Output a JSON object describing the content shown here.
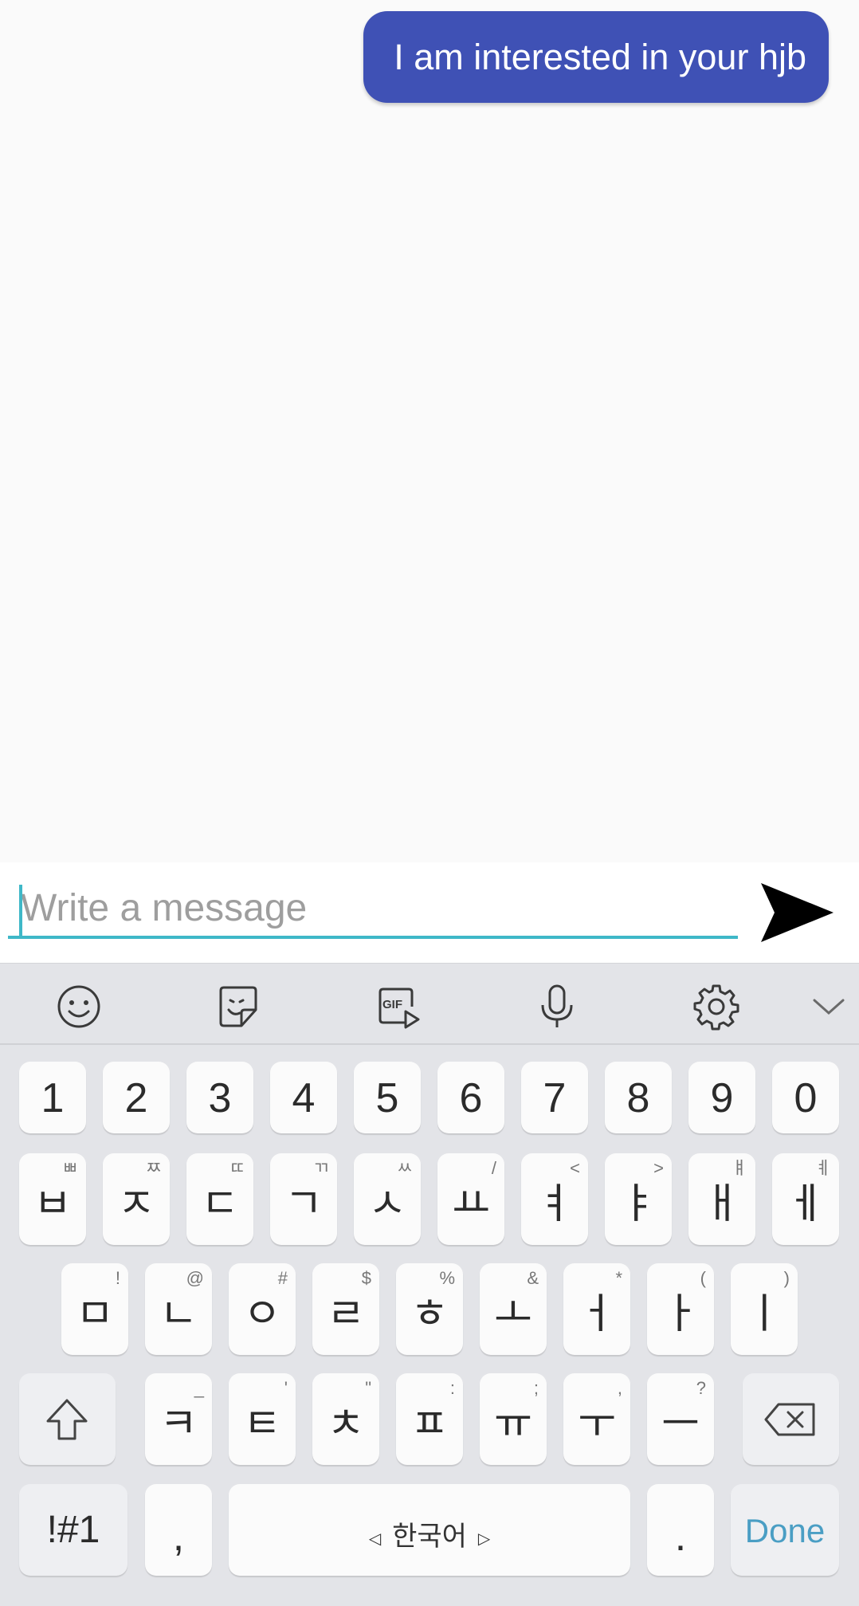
{
  "chat": {
    "messages": [
      {
        "text": "I am interested in your hjb",
        "side": "outgoing"
      }
    ],
    "bubble_color": "#3f51b5"
  },
  "composer": {
    "placeholder": "Write a message",
    "value": "",
    "accent_color": "#3fb8c8",
    "send_icon": "send-icon"
  },
  "keyboard": {
    "toolbar_icons": [
      "emoji-icon",
      "sticker-icon",
      "gif-icon",
      "microphone-icon",
      "settings-icon",
      "chevron-down-icon"
    ],
    "gif_label": "GIF",
    "number_row": [
      "1",
      "2",
      "3",
      "4",
      "5",
      "6",
      "7",
      "8",
      "9",
      "0"
    ],
    "row1": [
      {
        "main": "ㅂ",
        "sub": "ㅃ"
      },
      {
        "main": "ㅈ",
        "sub": "ㅉ"
      },
      {
        "main": "ㄷ",
        "sub": "ㄸ"
      },
      {
        "main": "ㄱ",
        "sub": "ㄲ"
      },
      {
        "main": "ㅅ",
        "sub": "ㅆ"
      },
      {
        "main": "ㅛ",
        "sub": "/"
      },
      {
        "main": "ㅕ",
        "sub": "<"
      },
      {
        "main": "ㅑ",
        "sub": ">"
      },
      {
        "main": "ㅐ",
        "sub": "ㅒ"
      },
      {
        "main": "ㅔ",
        "sub": "ㅖ"
      }
    ],
    "row2": [
      {
        "main": "ㅁ",
        "sub": "!"
      },
      {
        "main": "ㄴ",
        "sub": "@"
      },
      {
        "main": "ㅇ",
        "sub": "#"
      },
      {
        "main": "ㄹ",
        "sub": "$"
      },
      {
        "main": "ㅎ",
        "sub": "%"
      },
      {
        "main": "ㅗ",
        "sub": "&"
      },
      {
        "main": "ㅓ",
        "sub": "*"
      },
      {
        "main": "ㅏ",
        "sub": "("
      },
      {
        "main": "ㅣ",
        "sub": ")"
      }
    ],
    "row3": [
      {
        "main": "ㅋ",
        "sub": "_"
      },
      {
        "main": "ㅌ",
        "sub": "'"
      },
      {
        "main": "ㅊ",
        "sub": "\""
      },
      {
        "main": "ㅍ",
        "sub": ":"
      },
      {
        "main": "ㅠ",
        "sub": ";"
      },
      {
        "main": "ㅜ",
        "sub": ","
      },
      {
        "main": "ㅡ",
        "sub": "?"
      }
    ],
    "shift_icon": "shift-icon",
    "backspace_icon": "backspace-icon",
    "symbols_label": "!#1",
    "comma_label": ",",
    "space_label": "한국어",
    "period_label": ".",
    "done_label": "Done",
    "done_color": "#4a9ec4"
  }
}
